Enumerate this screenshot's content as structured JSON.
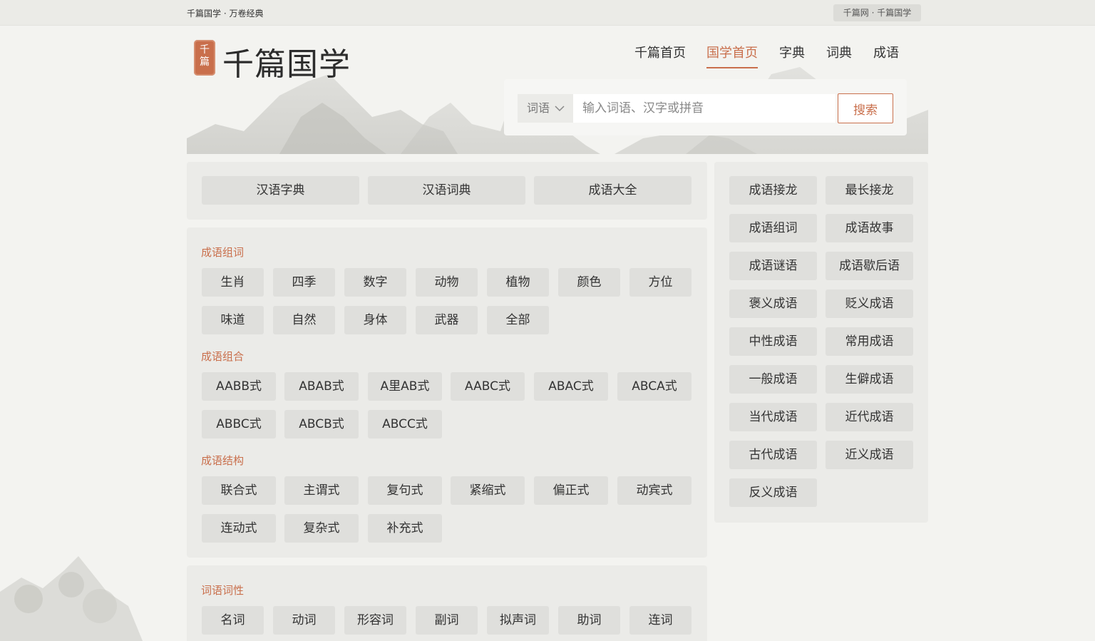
{
  "topbar": {
    "left_text": "千篇国学 · 万卷经典",
    "right_text": "千篇网 · 千篇国学"
  },
  "logo": {
    "seal_top": "千",
    "seal_bottom": "篇",
    "title": "千篇国学"
  },
  "nav": [
    "千篇首页",
    "国学首页",
    "字典",
    "词典",
    "成语"
  ],
  "nav_active": "国学首页",
  "search": {
    "select_label": "词语",
    "placeholder": "输入词语、汉字或拼音",
    "button": "搜索"
  },
  "quick_links": [
    "汉语字典",
    "汉语词典",
    "成语大全"
  ],
  "sections": {
    "idiom_words": {
      "title": "成语组词",
      "items": [
        "生肖",
        "四季",
        "数字",
        "动物",
        "植物",
        "颜色",
        "方位",
        "味道",
        "自然",
        "身体",
        "武器",
        "全部"
      ]
    },
    "idiom_combo": {
      "title": "成语组合",
      "items": [
        "AABB式",
        "ABAB式",
        "A里AB式",
        "AABC式",
        "ABAC式",
        "ABCA式",
        "ABBC式",
        "ABCB式",
        "ABCC式"
      ]
    },
    "idiom_struct": {
      "title": "成语结构",
      "items": [
        "联合式",
        "主谓式",
        "复句式",
        "紧缩式",
        "偏正式",
        "动宾式",
        "连动式",
        "复杂式",
        "补充式"
      ]
    },
    "word_pos": {
      "title": "词语词性",
      "items": [
        "名词",
        "动词",
        "形容词",
        "副词",
        "拟声词",
        "助词",
        "连词"
      ]
    }
  },
  "side_links": [
    "成语接龙",
    "最长接龙",
    "成语组词",
    "成语故事",
    "成语谜语",
    "成语歇后语",
    "褒义成语",
    "贬义成语",
    "中性成语",
    "常用成语",
    "一般成语",
    "生僻成语",
    "当代成语",
    "近代成语",
    "古代成语",
    "近义成语",
    "反义成语"
  ],
  "colors": {
    "accent": "#c96f4c",
    "panel": "#ebebe8",
    "button": "#dfdfdc",
    "background": "#f3f3f0"
  }
}
